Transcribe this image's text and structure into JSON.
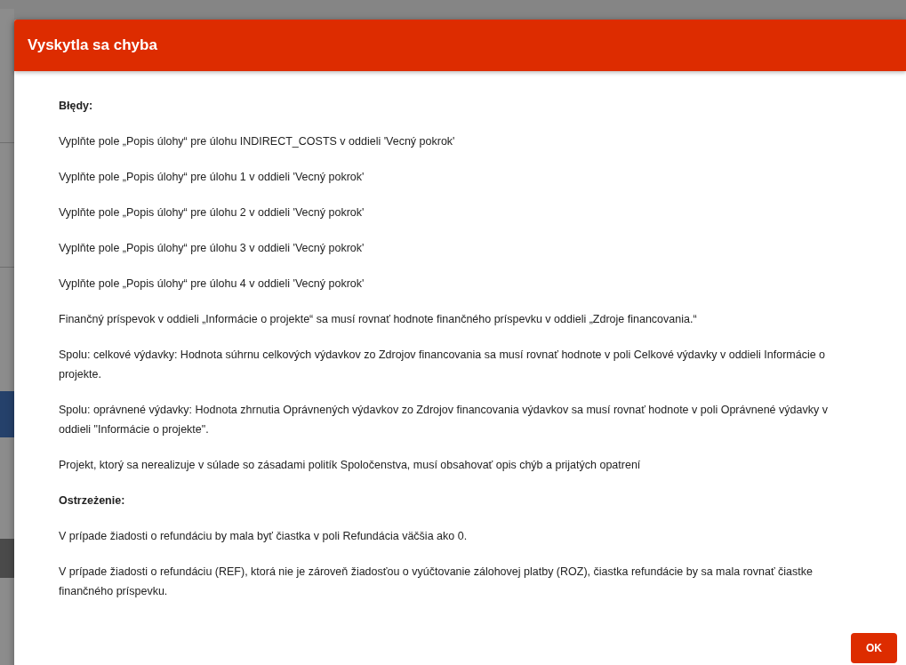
{
  "dialog": {
    "title": "Vyskytla sa chyba",
    "sections": [
      {
        "heading": "Błędy:",
        "messages": [
          "Vyplňte pole „Popis úlohy“ pre úlohu INDIRECT_COSTS v oddieli 'Vecný pokrok'",
          "Vyplňte pole „Popis úlohy“ pre úlohu 1 v oddieli 'Vecný pokrok'",
          "Vyplňte pole „Popis úlohy“ pre úlohu 2 v oddieli 'Vecný pokrok'",
          "Vyplňte pole „Popis úlohy“ pre úlohu 3 v oddieli 'Vecný pokrok'",
          "Vyplňte pole „Popis úlohy“ pre úlohu 4 v oddieli 'Vecný pokrok'",
          "Finančný príspevok v oddieli „Informácie o projekte“ sa musí rovnať hodnote finančného príspevku v oddieli „Zdroje financovania.“",
          "Spolu: celkové výdavky: Hodnota súhrnu celkových výdavkov zo Zdrojov financovania sa musí rovnať hodnote v poli Celkové výdavky v oddieli Informácie o projekte.",
          "Spolu: oprávnené výdavky: Hodnota zhrnutia Oprávnených výdavkov zo Zdrojov financovania výdavkov sa musí rovnať hodnote v poli Oprávnené výdavky v oddieli \"Informácie o projekte\".",
          "Projekt, ktorý sa nerealizuje v súlade so zásadami politík Spoločenstva, musí obsahovať opis chýb a prijatých opatrení"
        ]
      },
      {
        "heading": "Ostrzeżenie:",
        "messages": [
          "V prípade žiadosti o refundáciu by mala byť čiastka v poli Refundácia väčšia ako 0.",
          "V prípade žiadosti o refundáciu (REF), ktorá nie je zároveň žiadosťou o vyúčtovanie zálohovej platby (ROZ), čiastka refundácie by sa mala rovnať čiastke finančného príspevku."
        ]
      }
    ],
    "button": "OK"
  }
}
